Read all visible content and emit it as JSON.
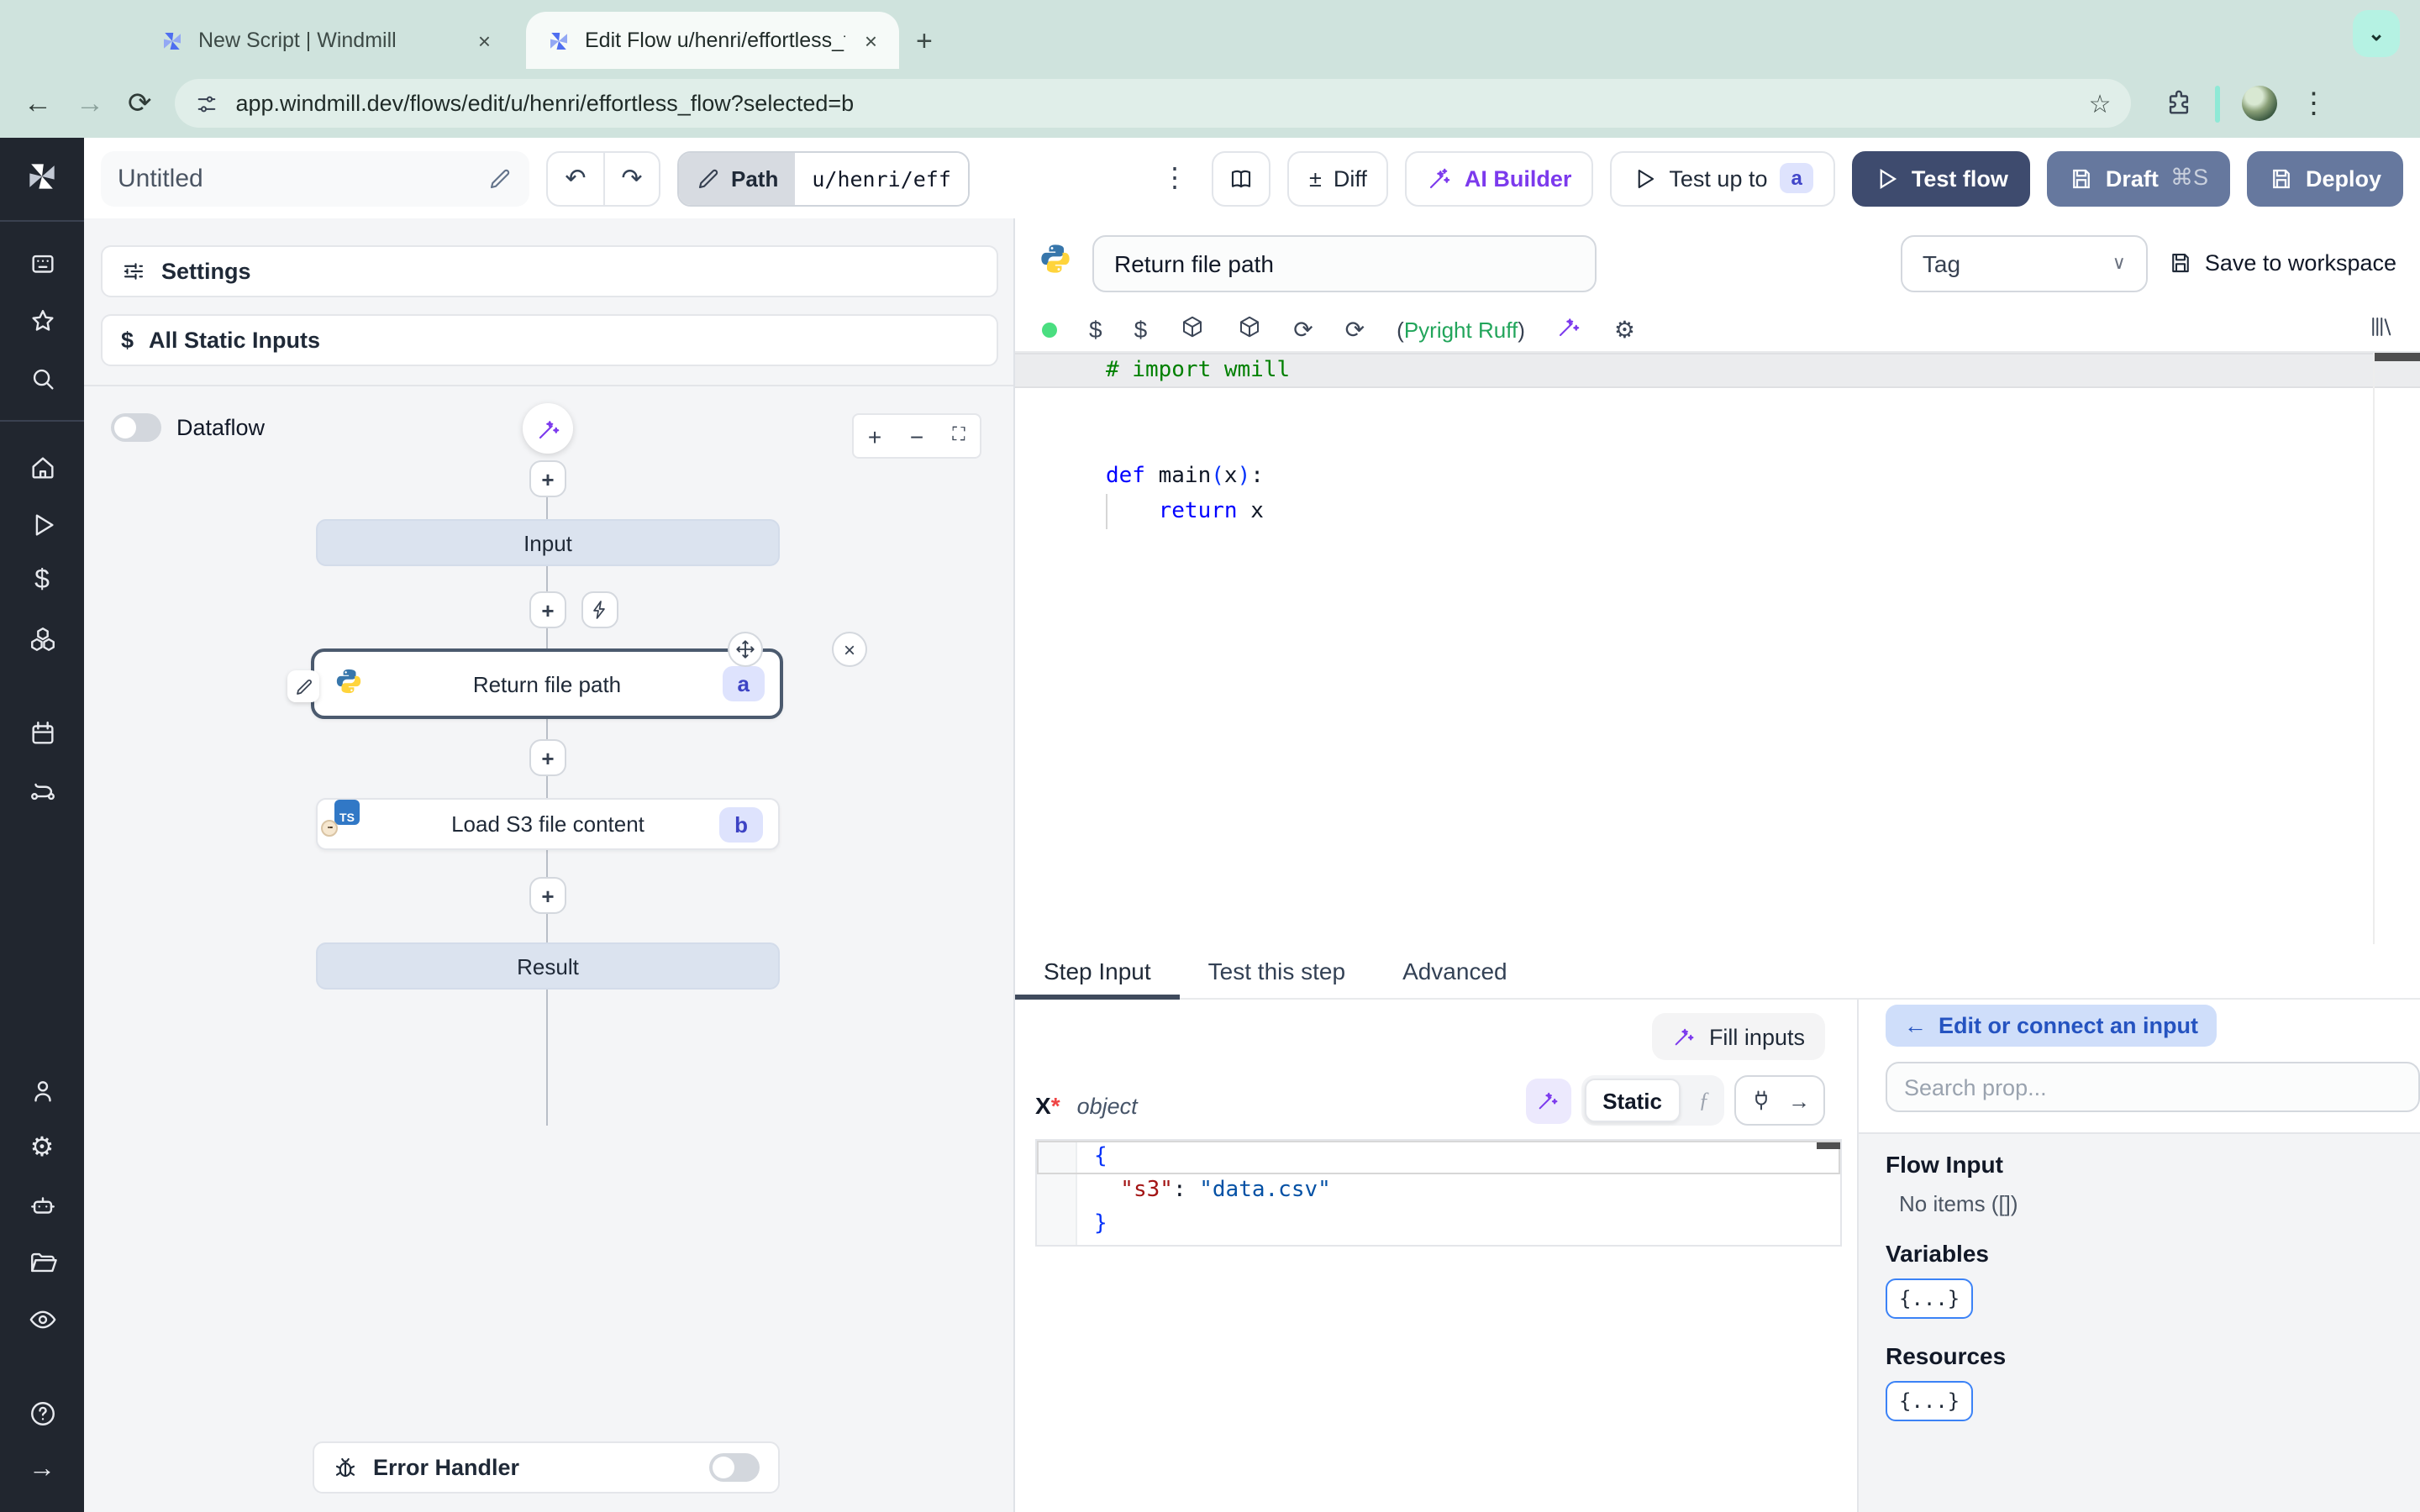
{
  "browser": {
    "tabs": [
      {
        "title": "New Script | Windmill"
      },
      {
        "title": "Edit Flow u/henri/effortless_fl"
      }
    ],
    "url": "app.windmill.dev/flows/edit/u/henri/effortless_flow?selected=b"
  },
  "icons": {
    "close": "×",
    "plus": "+",
    "minus": "−",
    "fullscreen": "⛶",
    "back": "←",
    "forward": "→",
    "reload": "⟳",
    "kebab": "⋮",
    "undo": "↶",
    "redo": "↷",
    "star": "☆",
    "plusminus": "±",
    "dollar": "$",
    "home": "⌂",
    "play": "▷",
    "gear": "⚙",
    "help": "?",
    "arrow_right": "→",
    "chevron_down": "∨",
    "apps": "▦",
    "cubes": "❖",
    "fx": "ƒ",
    "braces": "{...}",
    "chevron_tab": "⌄"
  },
  "toolbar": {
    "flow_name": "Untitled",
    "path_label": "Path",
    "path_value": "u/henri/eff",
    "diff": "Diff",
    "ai_builder": "AI Builder",
    "test_up_to": "Test up to",
    "test_up_to_badge": "a",
    "test_flow": "Test flow",
    "draft": "Draft",
    "draft_shortcut": "⌘S",
    "deploy": "Deploy"
  },
  "flow_panel": {
    "settings": "Settings",
    "all_static_inputs": "All Static Inputs",
    "dataflow": "Dataflow",
    "nodes": {
      "input": "Input",
      "step_a": "Return file path",
      "badge_a": "a",
      "step_b": "Load S3 file content",
      "badge_b": "b",
      "result": "Result"
    },
    "error_handler": "Error Handler"
  },
  "editor": {
    "script_name": "Return file path",
    "tag_placeholder": "Tag",
    "save_to_workspace": "Save to workspace",
    "lint_open": "(",
    "lint_words": "Pyright Ruff",
    "lint_close": ")",
    "code": {
      "l1": {
        "comment": "# import wmill"
      },
      "l4": {
        "kw": "def",
        "name": " main",
        "p1": "(",
        "arg": "x",
        "p2": ")",
        "colon": ":"
      },
      "l5": {
        "kw": "    return",
        "rest": " x"
      }
    }
  },
  "tabs": {
    "step_input": "Step Input",
    "test_this_step": "Test this step",
    "advanced": "Advanced"
  },
  "step_input": {
    "fill_inputs": "Fill inputs",
    "field_name": "X",
    "required_mark": "*",
    "field_type": "object",
    "static_label": "Static",
    "json": {
      "open": "{",
      "key": "  \"s3\"",
      "colon": ": ",
      "value": "\"data.csv\"",
      "close": "}"
    }
  },
  "connect_panel": {
    "back_arrow": "←",
    "edit_or_connect": "Edit or connect an input",
    "search_placeholder": "Search prop...",
    "flow_input": "Flow Input",
    "no_items": "No items ([])",
    "variables": "Variables",
    "resources": "Resources"
  },
  "colors": {
    "accent_indigo": "#4146c9",
    "primary_navy": "#3e4b6e",
    "secondary_slate": "#66789e",
    "ai_purple": "#7c3aed",
    "lint_green": "#22a55b",
    "status_green": "#4ade80",
    "chrome_mint": "#cfe3dd"
  }
}
